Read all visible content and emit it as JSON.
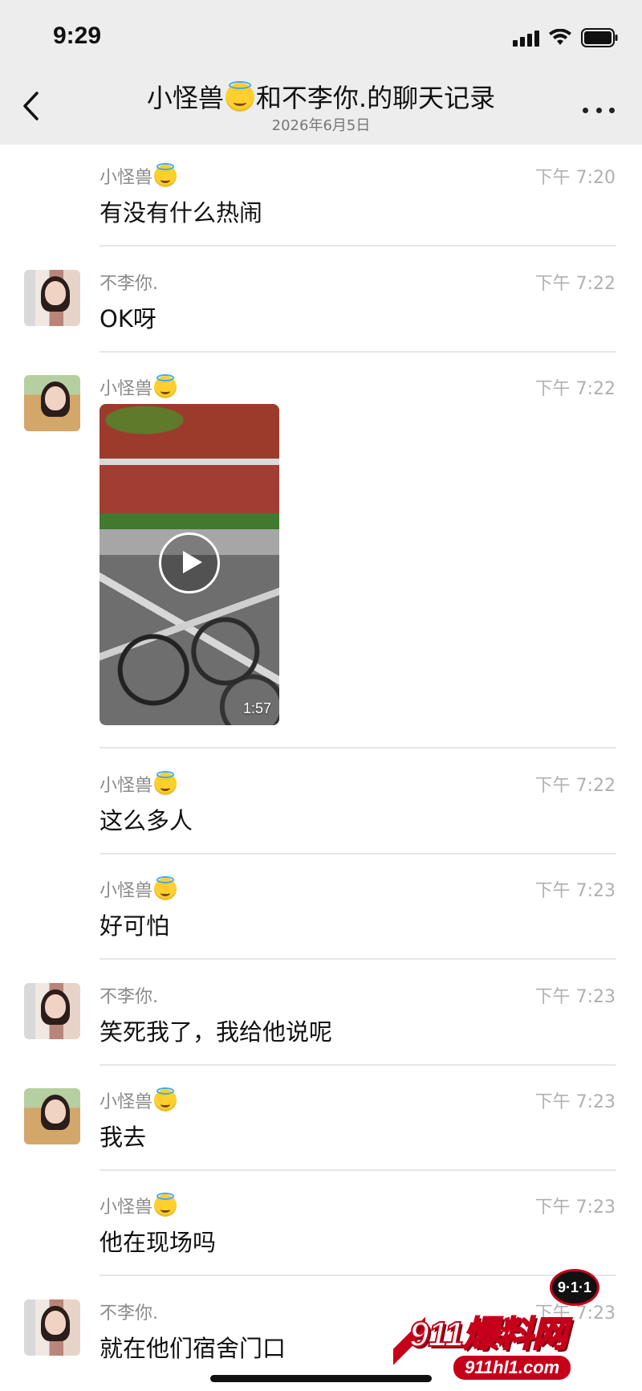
{
  "status_bar": {
    "time": "9:29"
  },
  "header": {
    "title_part1": "小怪兽",
    "title_part2": "和不李你.的聊天记录",
    "date": "2026年6月5日"
  },
  "messages": [
    {
      "sender": "小怪兽",
      "time": "下午 7:20",
      "text": "有没有什么热闹"
    },
    {
      "sender": "不李你.",
      "time": "下午 7:22",
      "text": "OK呀"
    },
    {
      "sender": "小怪兽",
      "time": "下午 7:22",
      "video_duration": "1:57"
    },
    {
      "sender": "小怪兽",
      "time": "下午 7:22",
      "text": "这么多人"
    },
    {
      "sender": "小怪兽",
      "time": "下午 7:23",
      "text": "好可怕"
    },
    {
      "sender": "不李你.",
      "time": "下午 7:23",
      "text": "笑死我了，我给他说呢"
    },
    {
      "sender": "小怪兽",
      "time": "下午 7:23",
      "text": "我去"
    },
    {
      "sender": "小怪兽",
      "time": "下午 7:23",
      "text": "他在现场吗"
    },
    {
      "sender": "不李你.",
      "time": "下午 7:23",
      "text": "就在他们宿舍门口"
    }
  ],
  "watermark": {
    "brand": "911爆料网",
    "site": "911hl1.com",
    "badge": "9·1·1"
  },
  "colors": {
    "header_bg": "#ededed",
    "divider": "#e6e6e6",
    "watermark_red": "#c6001a"
  },
  "icons": [
    "back-chevron-icon",
    "more-icon",
    "signal-icon",
    "wifi-icon",
    "battery-icon",
    "play-icon",
    "halo-smile-emoji-icon"
  ]
}
